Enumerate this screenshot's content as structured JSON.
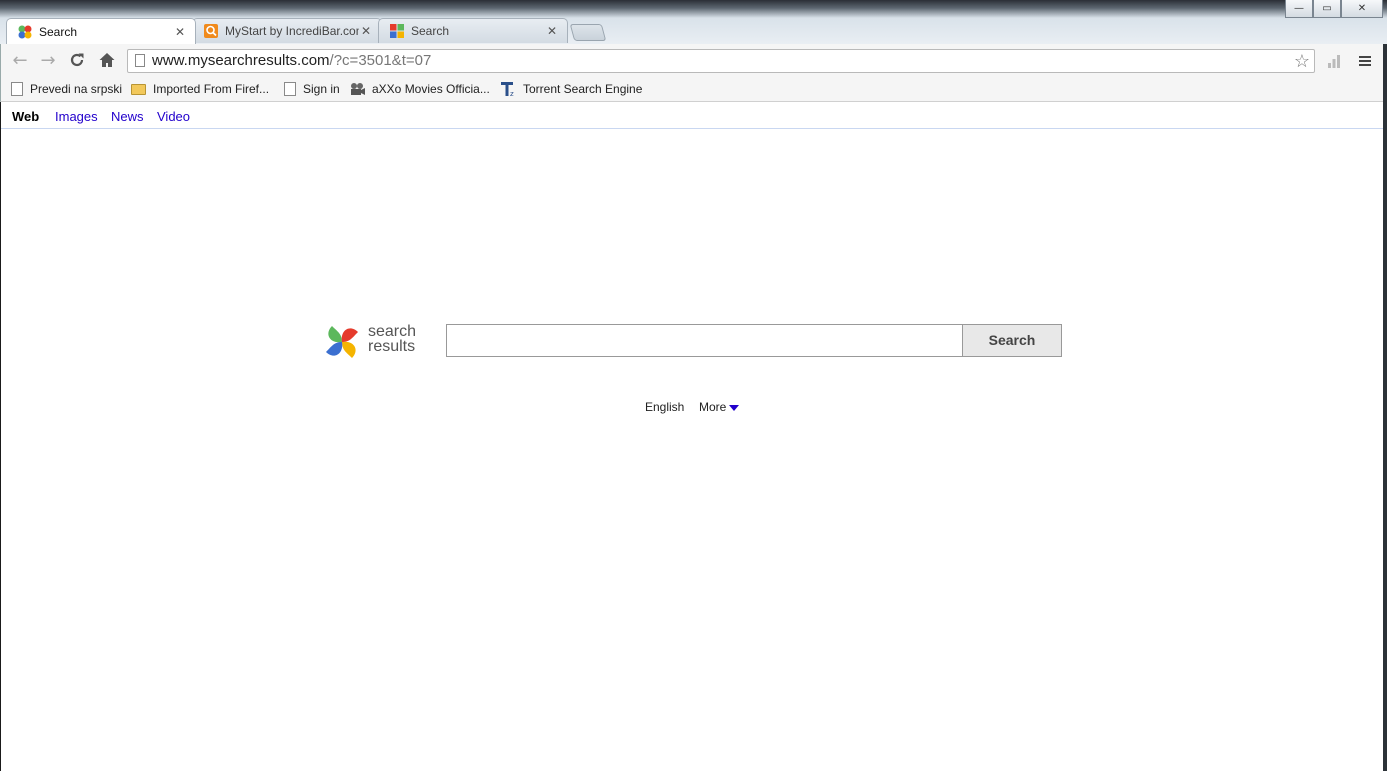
{
  "window": {
    "controls": {
      "minimize": "—",
      "restore": "▭",
      "close": "✕"
    }
  },
  "tabs": [
    {
      "title": "Search",
      "active": true,
      "icon": "pinwheel-icon"
    },
    {
      "title": "MyStart by IncrediBar.com",
      "active": false,
      "icon": "mystart-icon"
    },
    {
      "title": "Search",
      "active": false,
      "icon": "windows-flag-icon"
    }
  ],
  "toolbar": {
    "url_host": "www.mysearchresults.com",
    "url_path": "/?c=3501&t=07"
  },
  "bookmarks": [
    {
      "label": "Prevedi na srpski",
      "icon": "page-icon"
    },
    {
      "label": "Imported From Firef...",
      "icon": "folder-icon"
    },
    {
      "label": "Sign in",
      "icon": "page-icon"
    },
    {
      "label": "aXXo Movies Officia...",
      "icon": "film-reel-icon"
    },
    {
      "label": "Torrent Search Engine",
      "icon": "torrentz-icon"
    }
  ],
  "nav": {
    "web": "Web",
    "images": "Images",
    "news": "News",
    "video": "Video"
  },
  "logo": {
    "line1": "search",
    "line2": "results"
  },
  "search": {
    "value": "",
    "button": "Search"
  },
  "footer": {
    "language": "English",
    "more": "More"
  },
  "colors": {
    "link": "#2200cc",
    "logo_red": "#e53b2c",
    "logo_green": "#5cb85c",
    "logo_blue": "#3b6fd0",
    "logo_yellow": "#f5b400"
  }
}
